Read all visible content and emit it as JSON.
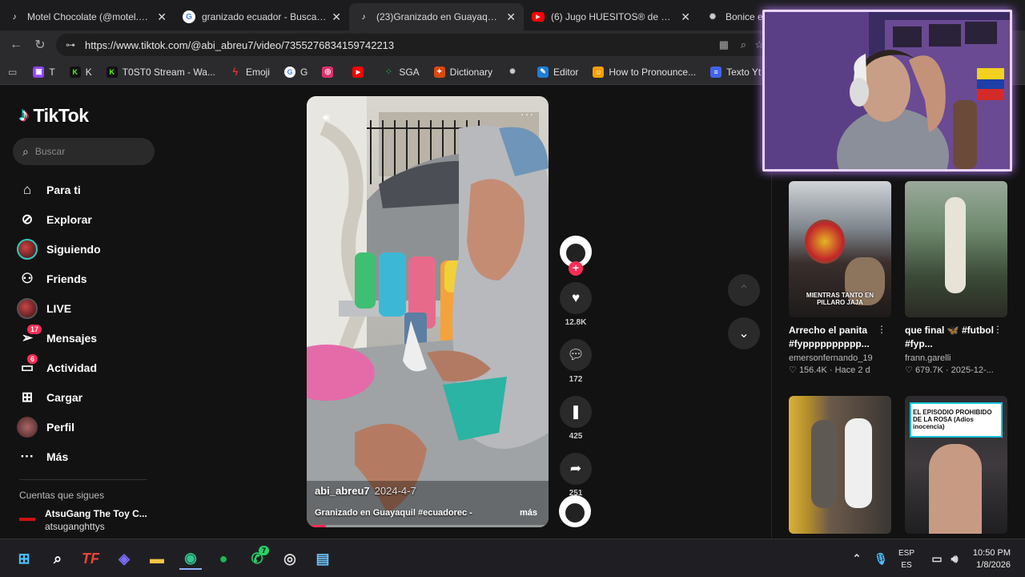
{
  "browser": {
    "tabs": [
      {
        "title": "Motel Chocolate (@motel.chocolate",
        "icon": "tiktok-icon",
        "active": false
      },
      {
        "title": "granizado ecuador - Buscar con",
        "icon": "google-icon",
        "active": false
      },
      {
        "title": "(23)Granizado en Guayaquil - De",
        "icon": "tiktok-icon",
        "active": true
      },
      {
        "title": "(6) Jugo HUESITOS® de Nestlé \\",
        "icon": "youtube-icon",
        "active": false
      },
      {
        "title": "Bonice en Ec",
        "icon": "chatgpt-icon",
        "active": false
      }
    ],
    "url": "https://www.tiktok.com/@abi_abreu7/video/7355276834159742213",
    "bookmarks": [
      {
        "label": "T",
        "color": "#9146ff"
      },
      {
        "label": "K",
        "color": "#53fc18"
      },
      {
        "label": "T0ST0 Stream - Wa...",
        "color": "#53fc18"
      },
      {
        "label": "Emoji",
        "color": "#e03131"
      },
      {
        "label": "G",
        "color": "#4285f4"
      },
      {
        "label": "",
        "color": "#e1306c"
      },
      {
        "label": "",
        "color": "#ff0000"
      },
      {
        "label": "SGA",
        "color": "#2b8a3e"
      },
      {
        "label": "Dictionary",
        "color": "#d9480f"
      },
      {
        "label": "",
        "color": "#888888"
      },
      {
        "label": "Editor",
        "color": "#1c7ed6"
      },
      {
        "label": "How to Pronounce...",
        "color": "#f59f00"
      },
      {
        "label": "Texto Yt",
        "color": "#4263eb"
      }
    ]
  },
  "tiktok": {
    "logo": "TikTok",
    "search_placeholder": "Buscar",
    "nav": [
      {
        "label": "Para ti",
        "icon": "home-icon"
      },
      {
        "label": "Explorar",
        "icon": "compass-icon"
      },
      {
        "label": "Siguiendo",
        "icon": "following-avatar-icon"
      },
      {
        "label": "Friends",
        "icon": "friends-icon"
      },
      {
        "label": "LIVE",
        "icon": "live-icon"
      },
      {
        "label": "Mensajes",
        "icon": "messages-icon",
        "badge": "17"
      },
      {
        "label": "Actividad",
        "icon": "activity-icon",
        "badge": "6"
      },
      {
        "label": "Cargar",
        "icon": "upload-icon"
      },
      {
        "label": "Perfil",
        "icon": "profile-icon"
      },
      {
        "label": "Más",
        "icon": "more-icon"
      }
    ],
    "following_header": "Cuentas que sigues",
    "following": [
      {
        "name": "AtsuGang The Toy C...",
        "user": "atsuganghttys"
      }
    ],
    "video": {
      "author": "abi_abreu7",
      "date": "2024-4-7",
      "caption": "Granizado en Guayaquil  #ecuadorec -",
      "more": "más",
      "progress": 0.08
    },
    "actions": {
      "likes": "12.8K",
      "comments": "172",
      "saves": "425",
      "shares": "251"
    },
    "recommendations": [
      {
        "title": "Arrecho el panita #fypppppppppp...",
        "user": "emersonfernando_19",
        "likes": "156.4K",
        "date": "Hace 2 d",
        "overlay": "MIENTRAS TANTO EN PILLARO JAJA"
      },
      {
        "title": "que final 🦋 #futbol #fyp...",
        "user": "frann.garelli",
        "likes": "679.7K",
        "date": "2025-12-...",
        "overlay": ""
      },
      {
        "title": "",
        "user": "",
        "likes": "",
        "date": "",
        "overlay": ""
      },
      {
        "title": "",
        "user": "",
        "likes": "",
        "date": "",
        "overlay": "EL EPISODIO PROHIBIDO DE LA ROSA (Adios inocencia)"
      }
    ]
  },
  "taskbar": {
    "lang_line1": "ESP",
    "lang_line2": "ES",
    "time": "10:50 PM",
    "date": "1/8/2026",
    "whatsapp_badge": "7"
  }
}
